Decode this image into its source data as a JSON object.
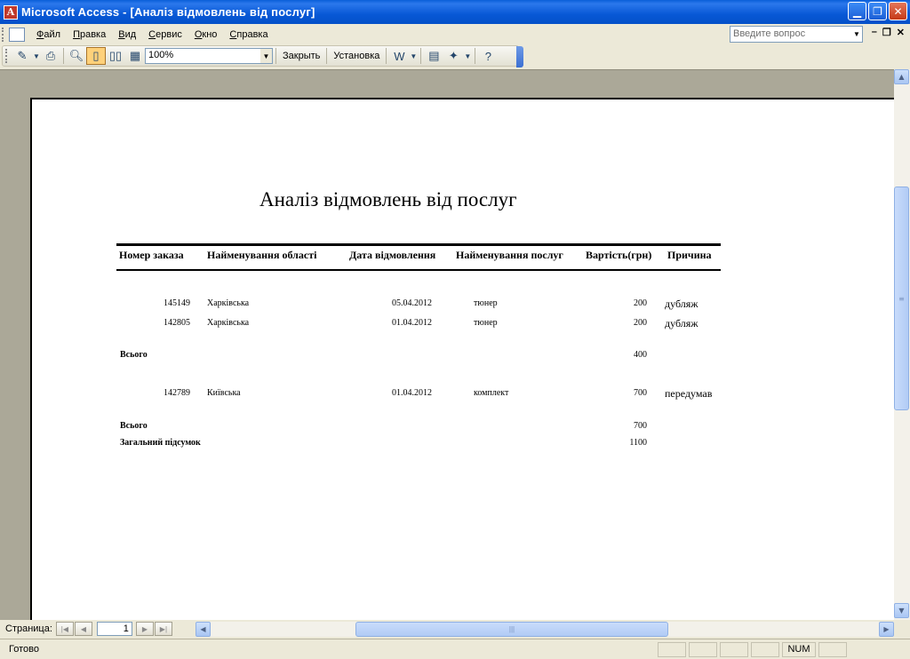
{
  "window": {
    "title": "Microsoft Access - [Аналіз відмовлень від послуг]",
    "app_icon": "access-icon",
    "accent": "#0a5fd8"
  },
  "menu": {
    "items": [
      "Файл",
      "Правка",
      "Вид",
      "Сервис",
      "Окно",
      "Справка"
    ],
    "help_placeholder": "Введите вопрос"
  },
  "toolbar": {
    "zoom": "100%",
    "close_label": "Закрыть",
    "setup_label": "Установка"
  },
  "report": {
    "title": "Аналіз відмовлень від послуг",
    "headers": {
      "order": "Номер заказа",
      "region": "Найменування області",
      "date": "Дата відмовлення",
      "service": "Найменування послуг",
      "cost": "Вартість(грн)",
      "reason": "Причина"
    },
    "group1": {
      "rows": [
        {
          "order": "145149",
          "region": "Харківська",
          "date": "05.04.2012",
          "service": "тюнер",
          "cost": "200",
          "reason": "дубляж"
        },
        {
          "order": "142805",
          "region": "Харківська",
          "date": "01.04.2012",
          "service": "тюнер",
          "cost": "200",
          "reason": "дубляж"
        }
      ],
      "total_label": "Всього",
      "total": "400"
    },
    "group2": {
      "rows": [
        {
          "order": "142789",
          "region": "Київська",
          "date": "01.04.2012",
          "service": "комплект",
          "cost": "700",
          "reason": "передумав"
        }
      ],
      "total_label": "Всього",
      "total": "700"
    },
    "grand_total_label": "Загальний підсумок",
    "grand_total": "1100"
  },
  "navigation": {
    "page_label": "Страница:",
    "page_number": "1"
  },
  "status": {
    "text": "Готово",
    "num": "NUM"
  }
}
